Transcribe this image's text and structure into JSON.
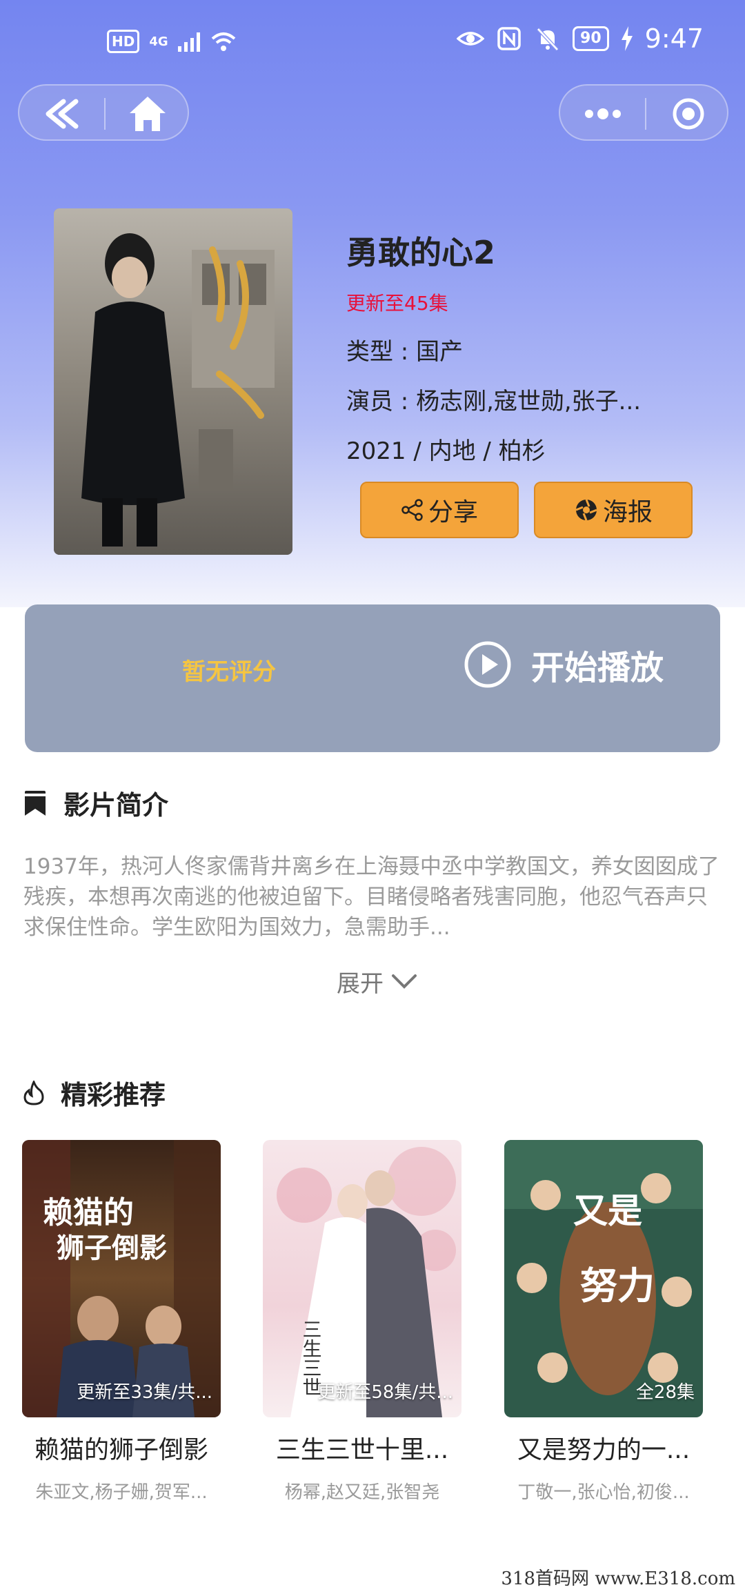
{
  "status_bar": {
    "hd": "HD",
    "network": "4G",
    "battery": "90",
    "time": "9:47"
  },
  "movie": {
    "title": "勇敢的心2",
    "update_status": "更新至45集",
    "genre_line": "类型 : 国产",
    "cast_line": "演员 : 杨志刚,寇世勋,张子...",
    "meta_line": "2021 / 内地 / 柏杉",
    "share_label": "分享",
    "poster_label": "海报"
  },
  "play_card": {
    "rating_text": "暂无评分",
    "play_label": "开始播放"
  },
  "synopsis": {
    "heading": "影片简介",
    "text": "1937年，热河人佟家儒背井离乡在上海聂中丞中学教国文，养女囡囡成了残疾，本想再次南逃的他被迫留下。目睹侵略者残害同胞，他忍气吞声只求保住性命。学生欧阳为国效力，急需助手...",
    "expand_label": "展开"
  },
  "recommendations": {
    "heading": "精彩推荐",
    "items": [
      {
        "title": "赖猫的狮子倒影",
        "badge": "更新至33集/共...",
        "cast": "朱亚文,杨子姗,贺军..."
      },
      {
        "title": "三生三世十里...",
        "badge": "更新至58集/共...",
        "cast": "杨幂,赵又廷,张智尧"
      },
      {
        "title": "又是努力的一...",
        "badge": "全28集",
        "cast": "丁敬一,张心怡,初俊..."
      }
    ]
  },
  "watermark": "318首码网 www.E318.com",
  "colors": {
    "hero_gradient_top": "#7485f0",
    "accent_orange": "#f4a43a",
    "update_red": "#e8113a",
    "rating_yellow": "#f5c542",
    "play_card": "#95a1b9"
  }
}
